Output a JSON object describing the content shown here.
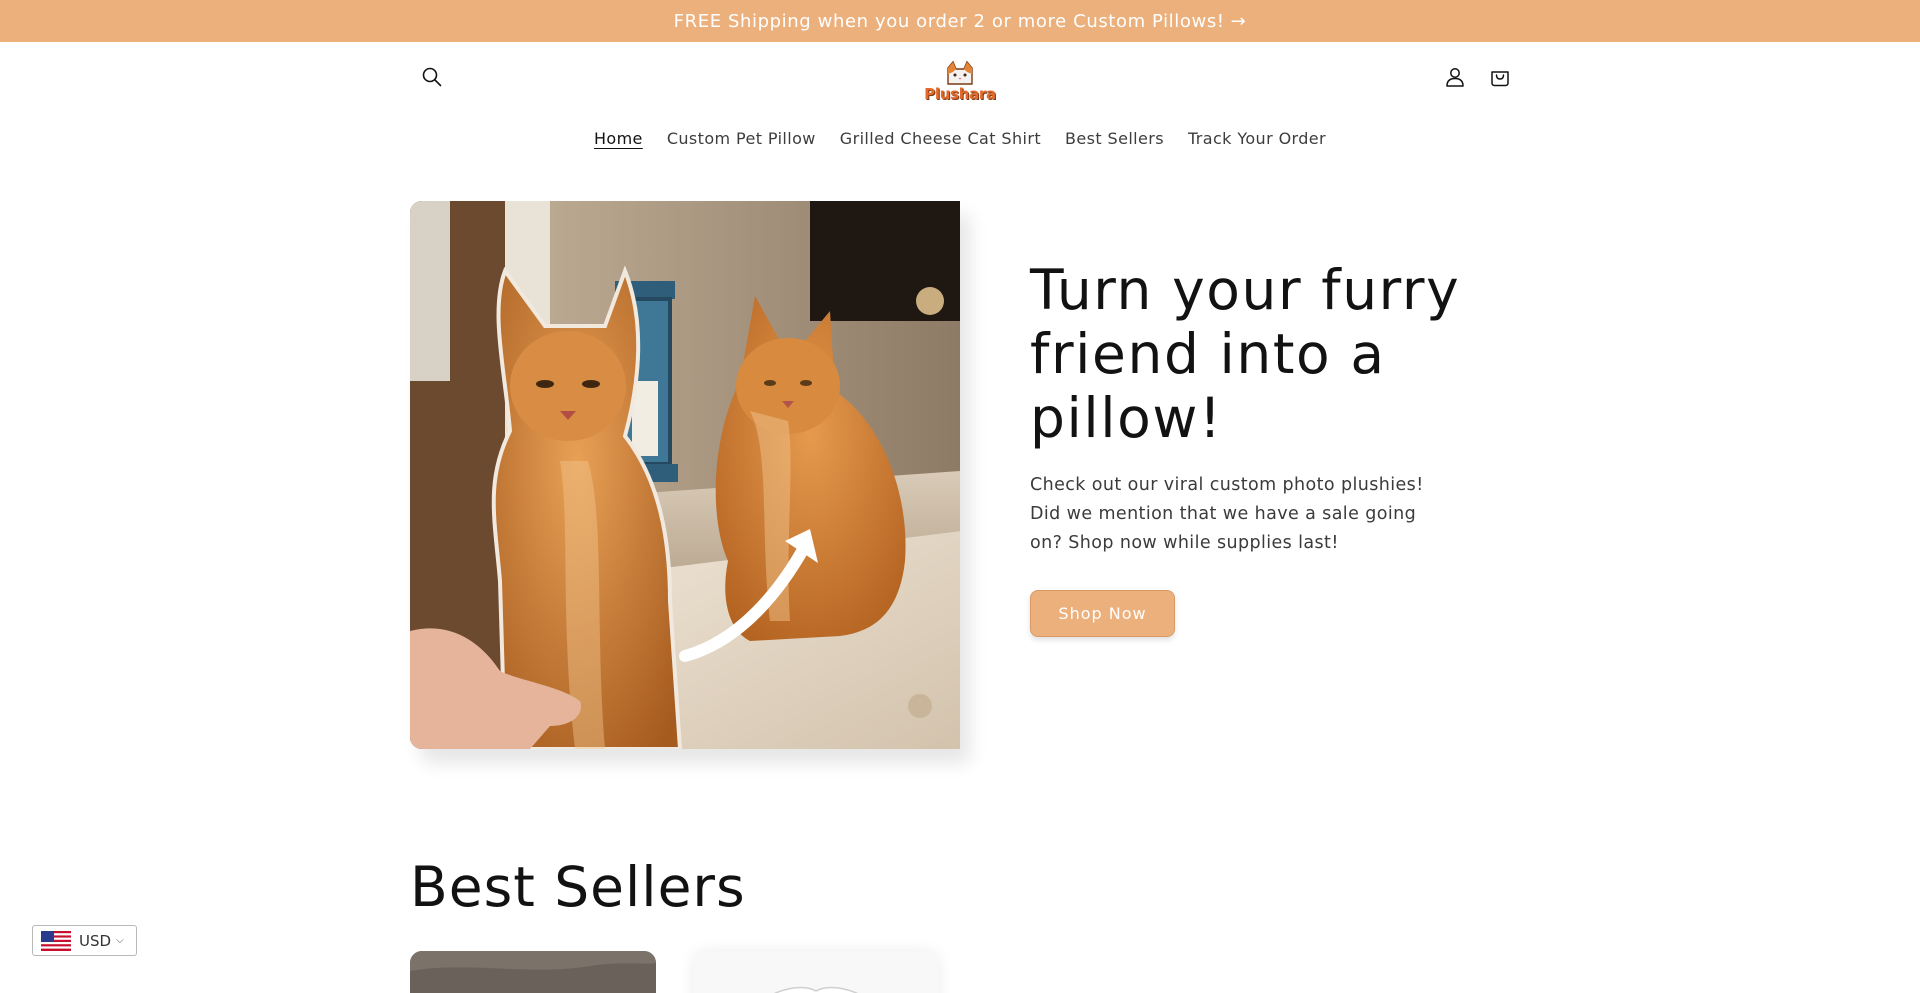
{
  "announcement": {
    "text": "FREE Shipping when you order 2 or more Custom Pillows!",
    "arrow": "→"
  },
  "header": {
    "logo_text": "Plushara",
    "icons": [
      "search-icon",
      "account-icon",
      "cart-icon"
    ]
  },
  "nav": {
    "items": [
      {
        "label": "Home",
        "active": true
      },
      {
        "label": "Custom Pet Pillow",
        "active": false
      },
      {
        "label": "Grilled Cheese Cat Shirt",
        "active": false
      },
      {
        "label": "Best Sellers",
        "active": false
      },
      {
        "label": "Track Your Order",
        "active": false
      }
    ]
  },
  "hero": {
    "title": "Turn your furry friend into a pillow!",
    "text": "Check out our viral custom photo plushies! Did we mention that we have a sale going on? Shop now while supplies last!",
    "button_label": "Shop Now"
  },
  "best_sellers": {
    "title": "Best Sellers"
  },
  "currency": {
    "code": "USD",
    "flag": "us-flag-icon"
  },
  "colors": {
    "accent": "#ecb07c",
    "text": "#121212",
    "logo": "#e26a2c"
  }
}
